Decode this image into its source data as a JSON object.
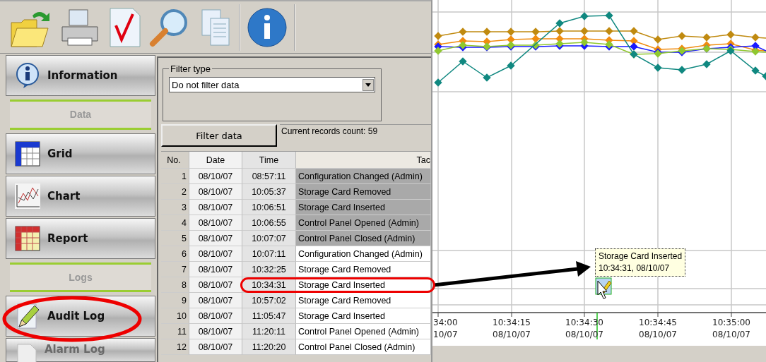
{
  "sidebar": {
    "items": [
      {
        "kind": "button",
        "label": "Information",
        "disabled": false
      },
      {
        "kind": "header",
        "label": "Data"
      },
      {
        "kind": "button",
        "label": "Grid",
        "disabled": false
      },
      {
        "kind": "button",
        "label": "Chart",
        "disabled": false
      },
      {
        "kind": "button",
        "label": "Report",
        "disabled": false
      },
      {
        "kind": "header",
        "label": "Logs"
      },
      {
        "kind": "button",
        "label": "Audit Log",
        "disabled": false
      },
      {
        "kind": "button",
        "label": "Alarm Log",
        "disabled": true
      }
    ]
  },
  "filter": {
    "legend": "Filter type",
    "value": "Do not filter data",
    "button": "Filter data",
    "records": "Current records count: 59"
  },
  "table": {
    "columns": [
      "No.",
      "Date",
      "Time",
      "Tac"
    ],
    "rows": [
      {
        "no": "1",
        "date": "08/10/07",
        "time": "08:57:11",
        "event": "Configuration Changed (Admin)",
        "selected": true
      },
      {
        "no": "2",
        "date": "08/10/07",
        "time": "10:05:37",
        "event": "Storage Card Removed",
        "selected": true
      },
      {
        "no": "3",
        "date": "08/10/07",
        "time": "10:06:51",
        "event": "Storage Card Inserted",
        "selected": true
      },
      {
        "no": "4",
        "date": "08/10/07",
        "time": "10:06:55",
        "event": "Control Panel Opened (Admin)",
        "selected": true
      },
      {
        "no": "5",
        "date": "08/10/07",
        "time": "10:07:07",
        "event": "Control Panel Closed (Admin)",
        "selected": true
      },
      {
        "no": "6",
        "date": "08/10/07",
        "time": "10:07:11",
        "event": "Configuration Changed (Admin)",
        "selected": false
      },
      {
        "no": "7",
        "date": "08/10/07",
        "time": "10:32:25",
        "event": "Storage Card Removed",
        "selected": false
      },
      {
        "no": "8",
        "date": "08/10/07",
        "time": "10:34:31",
        "event": "Storage Card Inserted",
        "selected": false
      },
      {
        "no": "9",
        "date": "08/10/07",
        "time": "10:57:02",
        "event": "Storage Card Removed",
        "selected": false
      },
      {
        "no": "10",
        "date": "08/10/07",
        "time": "11:05:47",
        "event": "Storage Card Inserted",
        "selected": false
      },
      {
        "no": "11",
        "date": "08/10/07",
        "time": "11:20:11",
        "event": "Control Panel Opened (Admin)",
        "selected": false
      },
      {
        "no": "12",
        "date": "08/10/07",
        "time": "11:20:20",
        "event": "Control Panel Closed (Admin)",
        "selected": false
      }
    ]
  },
  "chart": {
    "tooltip": {
      "title": "Storage Card Inserted",
      "time": "10:34:31, 08/10/07"
    },
    "x_labels": [
      {
        "time": "34:00",
        "date": "10/07"
      },
      {
        "time": "10:34:15",
        "date": "08/10/07"
      },
      {
        "time": "10:34:30",
        "date": "08/10/07"
      },
      {
        "time": "10:34:45",
        "date": "08/10/07"
      },
      {
        "time": "10:35:00",
        "date": "08/10/07"
      }
    ]
  }
}
